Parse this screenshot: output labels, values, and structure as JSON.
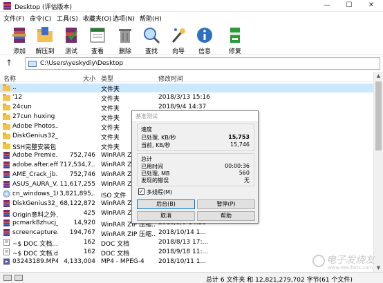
{
  "window": {
    "title": "Desktop (评估版本)",
    "controls": {
      "minimize": "—",
      "maximize": "☐",
      "close": "✕"
    }
  },
  "menu": [
    "文件(F)",
    "命令(C)",
    "工具(S)",
    "收藏夹(O)",
    "选项(N)",
    "帮助(H)"
  ],
  "toolbar": [
    {
      "label": "添加",
      "icon": "add-archive-icon"
    },
    {
      "label": "解压到",
      "icon": "extract-to-icon"
    },
    {
      "label": "测试",
      "icon": "test-icon"
    },
    {
      "label": "查看",
      "icon": "view-icon"
    },
    {
      "label": "删除",
      "icon": "delete-icon"
    },
    {
      "label": "查找",
      "icon": "find-icon"
    },
    {
      "label": "向导",
      "icon": "wizard-icon"
    },
    {
      "label": "信息",
      "icon": "info-icon"
    },
    {
      "label": "修复",
      "icon": "repair-icon"
    }
  ],
  "address": {
    "path": "C:\\Users\\yeskydiy\\Desktop",
    "up_glyph": "↑"
  },
  "columns": {
    "name": "名称",
    "size": "大小",
    "type": "类型",
    "modified": "修改时间"
  },
  "files": [
    {
      "name": "..",
      "size": "",
      "type": "文件夹",
      "date": "",
      "icon": "folder-up-icon",
      "selected": true
    },
    {
      "name": "'12",
      "size": "",
      "type": "文件夹",
      "date": "2018/3/13 15:16",
      "icon": "folder-icon"
    },
    {
      "name": "24cun",
      "size": "",
      "type": "文件夹",
      "date": "2018/9/4 14:37",
      "icon": "folder-icon"
    },
    {
      "name": "27cun huxing",
      "size": "",
      "type": "文件夹",
      "date": "",
      "icon": "folder-icon"
    },
    {
      "name": "Adobe Photos...",
      "size": "",
      "type": "文件夹",
      "date": "",
      "icon": "folder-icon"
    },
    {
      "name": "DiskGenius32_...",
      "size": "",
      "type": "文件夹",
      "date": "",
      "icon": "folder-icon"
    },
    {
      "name": "SSH完整安装包",
      "size": "",
      "type": "文件夹",
      "date": "",
      "icon": "folder-icon"
    },
    {
      "name": "Adobe Premie...",
      "size": "752,746",
      "type": "WinRAR Z",
      "date": "",
      "icon": "winrar-archive-icon"
    },
    {
      "name": "adobe.after.eff...",
      "size": "717,534,7...",
      "type": "WinRAR Z",
      "date": "",
      "icon": "winrar-archive-icon"
    },
    {
      "name": "AME_Crack_jb...",
      "size": "752,746",
      "type": "WinRAR Z",
      "date": "",
      "icon": "winrar-archive-icon"
    },
    {
      "name": "ASUS_AURA_V...",
      "size": "11,617,255",
      "type": "WinRAR Z",
      "date": "",
      "icon": "winrar-archive-icon"
    },
    {
      "name": "cn_windows_10...",
      "size": "3,821,895,...",
      "type": "ISO 文件",
      "date": "",
      "icon": "iso-file-icon"
    },
    {
      "name": "DiskGenius32_...",
      "size": "68,122,872",
      "type": "WinRAR Z",
      "date": "",
      "icon": "winrar-archive-icon"
    },
    {
      "name": "Origin意料之外...",
      "size": "425",
      "type": "WinRAR Z",
      "date": "",
      "icon": "winrar-archive-icon"
    },
    {
      "name": "pcmark8zhucj_...",
      "size": "14,920",
      "type": "WinRAR ZIP 压缩...",
      "date": "2018/5/9 14:28",
      "icon": "winrar-archive-icon"
    },
    {
      "name": "screencapture...",
      "size": "194,767",
      "type": "WinRAR ZIP 压缩...",
      "date": "2018/10/14 1...",
      "icon": "winrar-archive-icon"
    },
    {
      "name": "~$ DOC 文档...",
      "size": "162",
      "type": "DOC 文档",
      "date": "2018/8/13 17:...",
      "icon": "doc-file-icon"
    },
    {
      "name": "~$ DOC 文档.d...",
      "size": "162",
      "type": "DOC 文档",
      "date": "2018/9/18 11:...",
      "icon": "doc-file-icon"
    },
    {
      "name": "03243189.MP4",
      "size": "4,133,004",
      "type": "MP4 - MPEG-4",
      "date": "2018/10/11 1...",
      "icon": "video-file-icon"
    }
  ],
  "status": {
    "text": "总计 6 文件夹 和 12,821,279,702 字节(61 个文件)"
  },
  "dialog": {
    "title": "基准测试",
    "speed_header": "速度",
    "processed_rate_label": "已处理, KB/秒",
    "processed_rate_value": "15,753",
    "current_rate_label": "当前, KB/秒",
    "current_rate_value": "15,746",
    "total_header": "总计",
    "elapsed_label": "已用时间",
    "elapsed_value": "00:00:36",
    "processed_mb_label": "已处理, MB",
    "processed_mb_value": "560",
    "errors_label": "发现的错误",
    "errors_value": "无",
    "multithread_label": "多线程(M)",
    "multithread_checked": true,
    "check_glyph": "✓",
    "buttons": {
      "background": "后台(B)",
      "pause": "暂停(P)",
      "cancel": "取消",
      "help": "帮助"
    }
  },
  "watermark": {
    "line1": "电子发烧友",
    "line2": "www.elecfans.com"
  },
  "colors": {
    "selection": "#cce8ff",
    "folder": "#f0c350",
    "accent": "#0078d7"
  }
}
